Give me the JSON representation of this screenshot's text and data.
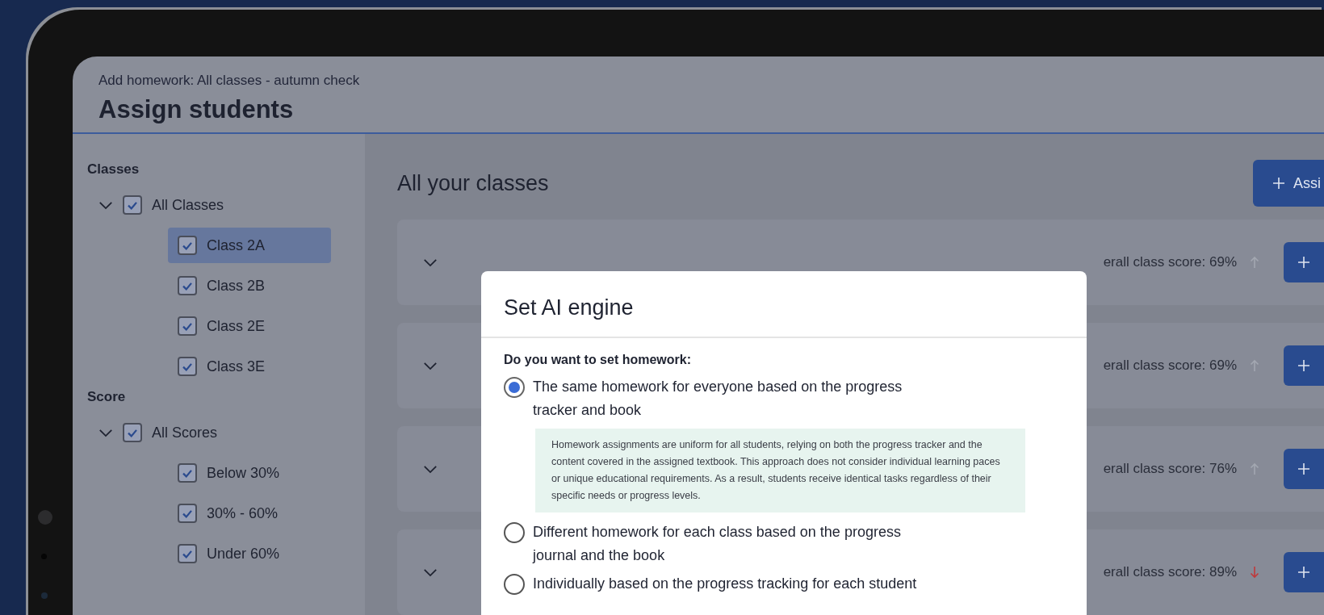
{
  "header": {
    "breadcrumb": "Add homework: All classes - autumn check",
    "title": "Assign students"
  },
  "sidebar": {
    "sections": [
      {
        "heading": "Classes",
        "items": [
          {
            "label": "All Classes",
            "checked": true,
            "expanded": true,
            "selected": false,
            "children": [
              {
                "label": "Class 2A",
                "checked": true,
                "selected": true
              },
              {
                "label": "Class 2B",
                "checked": true,
                "selected": false
              },
              {
                "label": "Class 2E",
                "checked": true,
                "selected": false
              },
              {
                "label": "Class 3E",
                "checked": true,
                "selected": false
              }
            ]
          }
        ]
      },
      {
        "heading": "Score",
        "items": [
          {
            "label": "All Scores",
            "checked": true,
            "expanded": true,
            "selected": false,
            "children": [
              {
                "label": "Below 30%",
                "checked": true,
                "selected": false
              },
              {
                "label": "30% - 60%",
                "checked": true,
                "selected": false
              },
              {
                "label": "Under 60%",
                "checked": true,
                "selected": false
              }
            ]
          }
        ]
      }
    ]
  },
  "main": {
    "title": "All your classes",
    "assign_button": "Assi",
    "cards": [
      {
        "score": "erall class score: 69%",
        "kind": "up"
      },
      {
        "score": "erall class score: 69%",
        "kind": "up"
      },
      {
        "score": "erall class score: 76%",
        "kind": "up"
      },
      {
        "score": "erall class score: 89%",
        "kind": "down"
      }
    ]
  },
  "modal": {
    "title": "Set AI engine",
    "question": "Do you want to set homework:",
    "options": [
      {
        "label": "The same homework for everyone based on the progress tracker and book",
        "selected": true,
        "description": "Homework assignments are uniform for all students, relying on both the progress tracker and the content covered in the assigned textbook. This approach does not consider individual learning paces or unique educational requirements. As a result, students receive identical tasks regardless of their specific needs or progress levels."
      },
      {
        "label": "Different homework for each class based on the progress journal and the book",
        "selected": false
      },
      {
        "label": "Individually based on the progress tracking for each student",
        "selected": false
      }
    ]
  }
}
